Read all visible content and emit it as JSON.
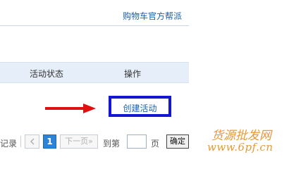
{
  "header": {
    "link_text": "购物车官方帮派"
  },
  "table": {
    "columns": [
      "活动状态",
      "操作"
    ],
    "rows": [
      {
        "action": "创建活动"
      }
    ]
  },
  "pager": {
    "records_text": "记录",
    "current_page": "1",
    "next_label": "下一页»",
    "goto_label": "到第",
    "page_input_value": "",
    "page_unit": "页",
    "confirm_label": "确定"
  },
  "annotation": {
    "arrow_color": "#e01010",
    "box_color": "#1515d4"
  },
  "watermark": {
    "line1": "货源批发网",
    "line2": "www.6pf.cn"
  }
}
